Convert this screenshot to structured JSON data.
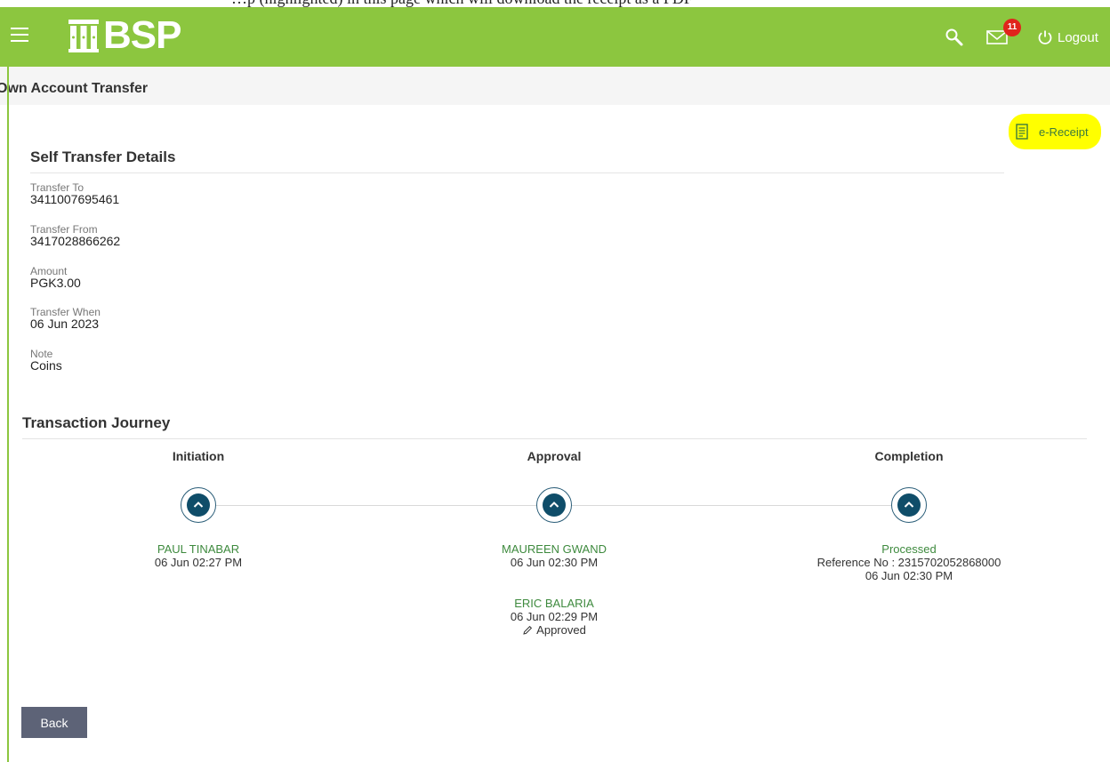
{
  "header": {
    "brand": "BSP",
    "logout_label": "Logout",
    "mail_badge_count": "11",
    "accent_color": "#8cc63f"
  },
  "page": {
    "title": "Own Account Transfer"
  },
  "top_strip_text": "…p (highlighted) in this page which will download the receipt as a PDF",
  "ereceipt": {
    "label": "e-Receipt",
    "highlight_color": "#ffff00"
  },
  "details": {
    "section_title": "Self Transfer Details",
    "fields": [
      {
        "label": "Transfer To",
        "value": "3411007695461"
      },
      {
        "label": "Transfer From",
        "value": "3417028866262"
      },
      {
        "label": "Amount",
        "value": "PGK3.00"
      },
      {
        "label": "Transfer When",
        "value": "06 Jun 2023"
      },
      {
        "label": "Note",
        "value": "Coins"
      }
    ]
  },
  "journey": {
    "section_title": "Transaction Journey",
    "stages": [
      {
        "title": "Initiation",
        "entries": [
          {
            "name": "PAUL TINABAR",
            "time": "06 Jun 02:27 PM"
          }
        ]
      },
      {
        "title": "Approval",
        "entries": [
          {
            "name": "MAUREEN GWAND",
            "time": "06 Jun 02:30 PM"
          },
          {
            "name": "ERIC BALARIA",
            "time": "06 Jun 02:29 PM",
            "status": "Approved"
          }
        ]
      },
      {
        "title": "Completion",
        "entries": [
          {
            "name": "Processed",
            "reference": "Reference No : 2315702052868000",
            "time": "06 Jun 02:30 PM"
          }
        ]
      }
    ]
  },
  "actions": {
    "back_label": "Back"
  }
}
